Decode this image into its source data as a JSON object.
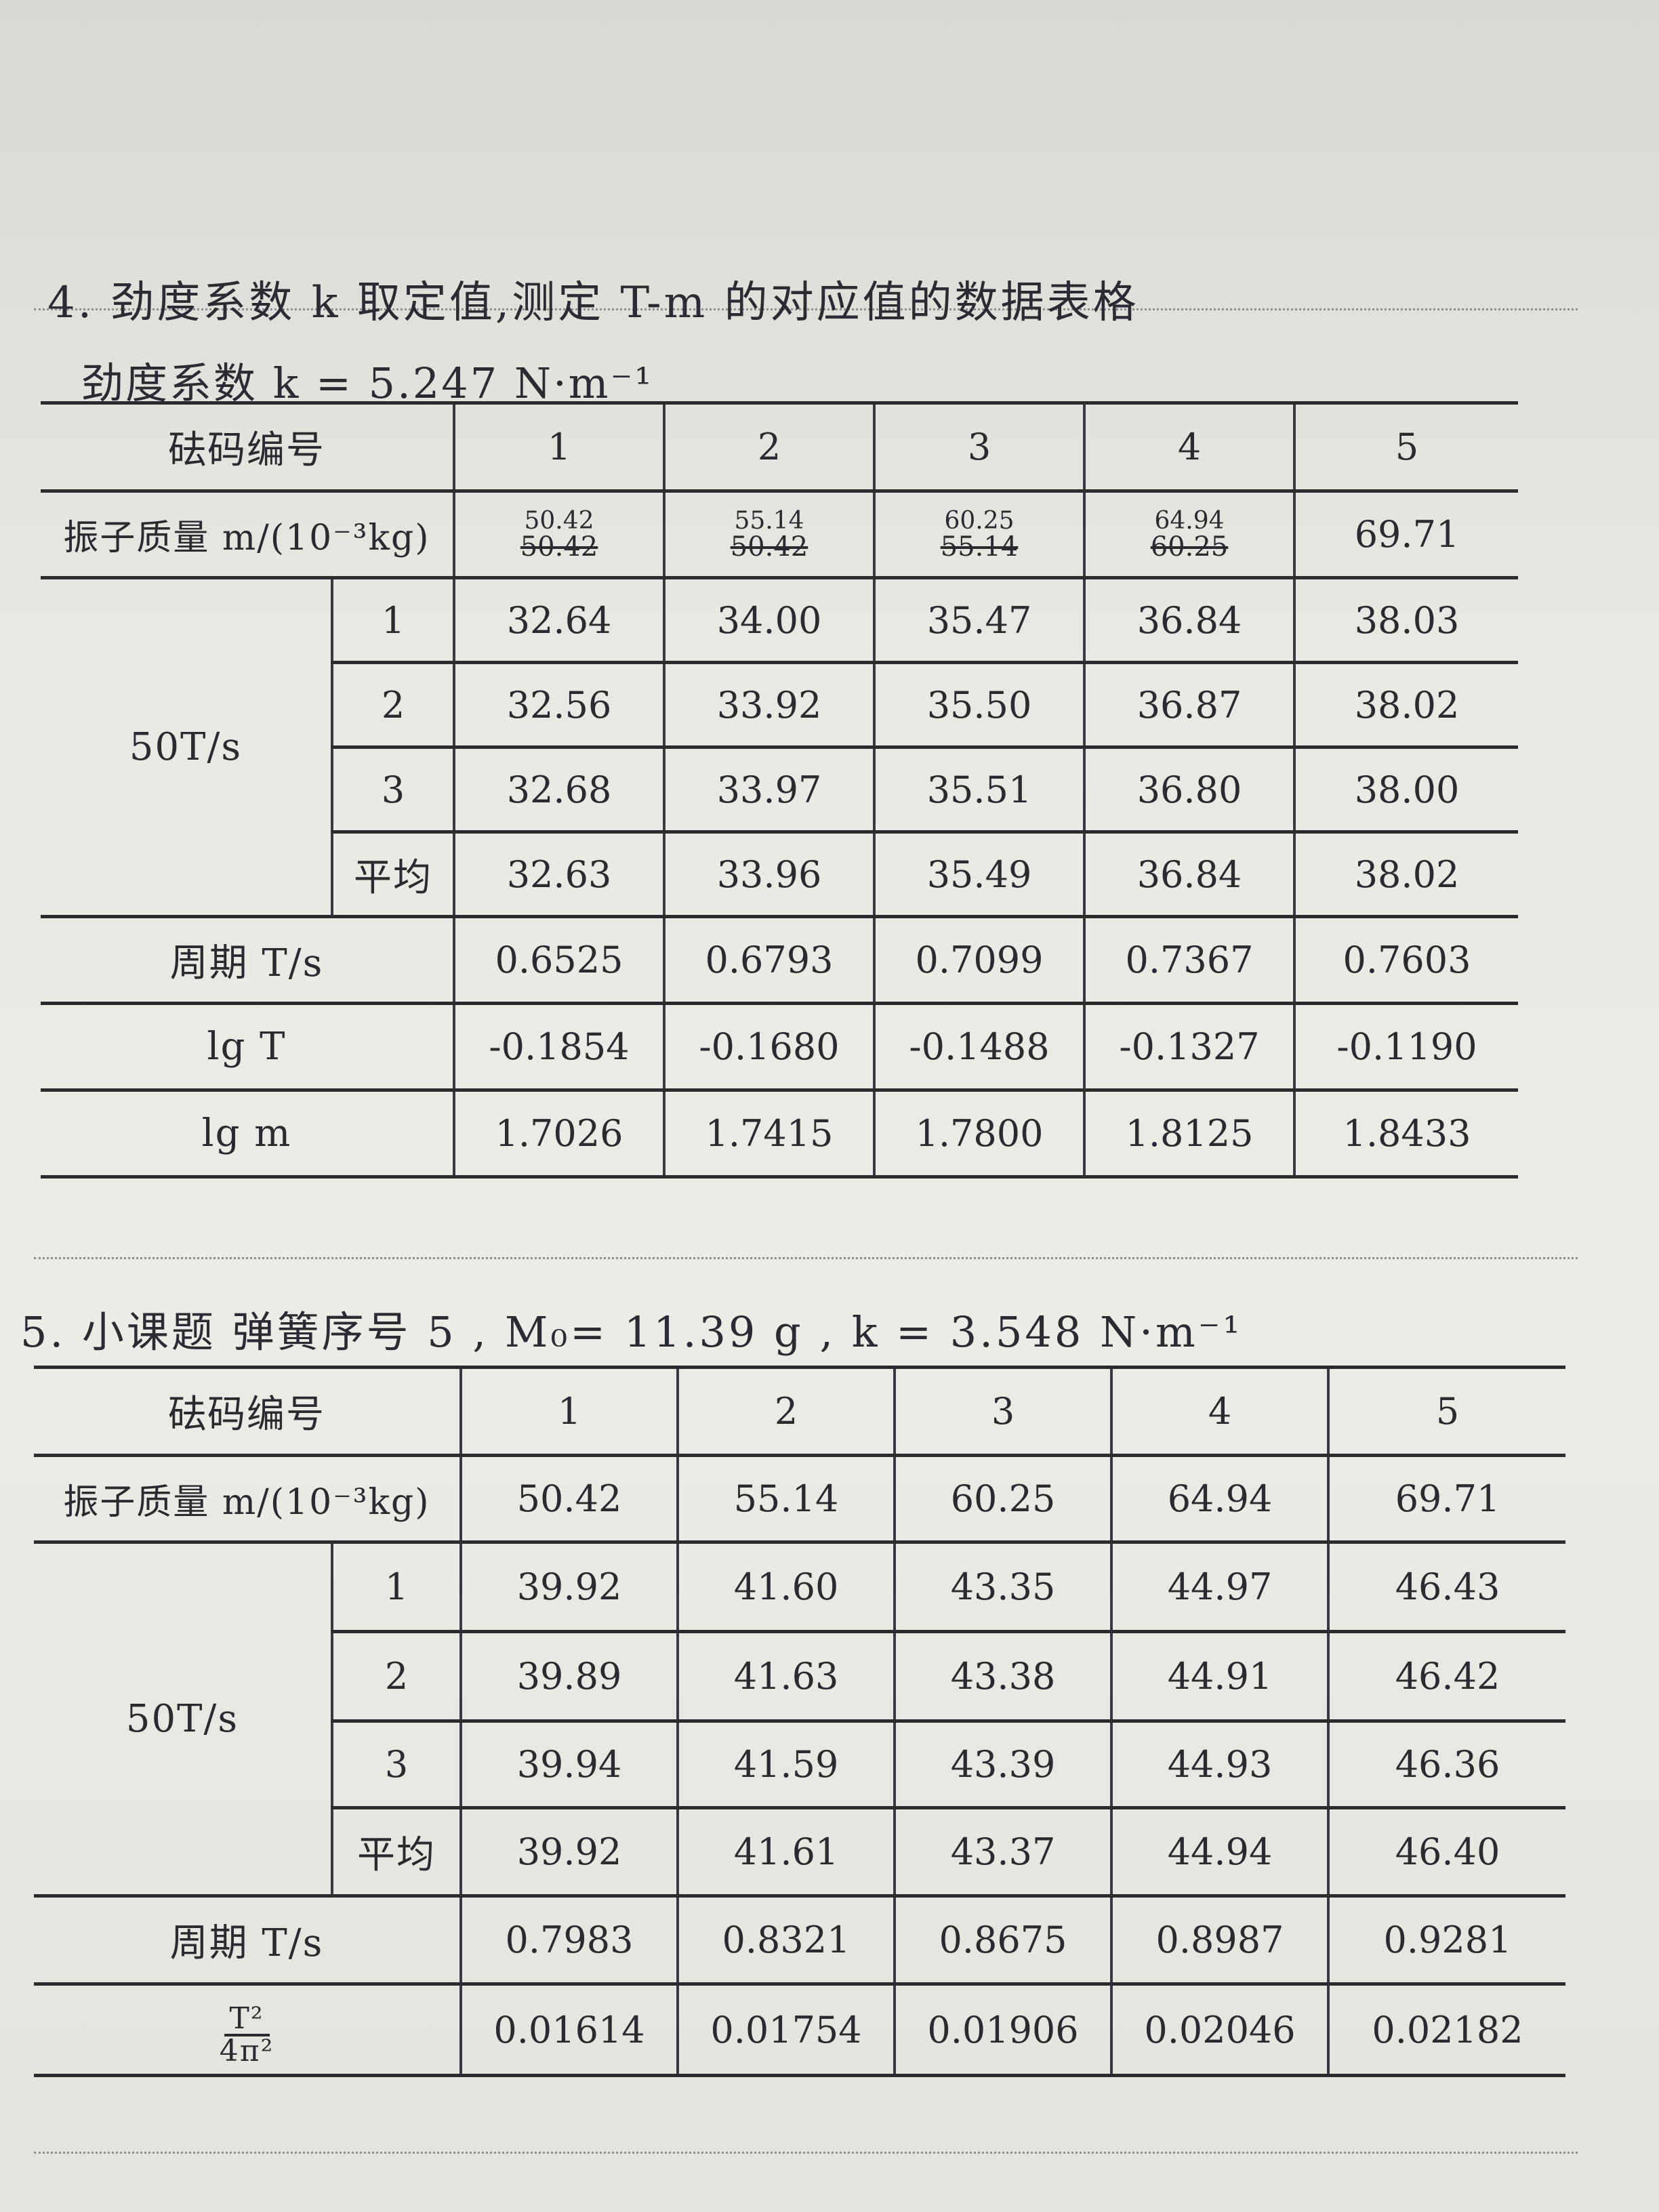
{
  "section4": {
    "heading": "4. 劲度系数 k 取定值,测定 T-m 的对应值的数据表格",
    "k_line": "劲度系数 k = 5.247 N·m⁻¹",
    "header_label": "砝码编号",
    "cols": [
      "1",
      "2",
      "3",
      "4",
      "5"
    ],
    "mass_label": "振子质量 m/(10⁻³kg)",
    "mass": [
      {
        "new": "50.42",
        "old": "50.42"
      },
      {
        "new": "55.14",
        "old": "50.42"
      },
      {
        "new": "60.25",
        "old": "55.14"
      },
      {
        "new": "64.94",
        "old": "60.25"
      },
      {
        "new": "69.71",
        "old": ""
      }
    ],
    "time_label": "50T/s",
    "trial_labels": [
      "1",
      "2",
      "3",
      "平均"
    ],
    "trials": [
      [
        "32.64",
        "34.00",
        "35.47",
        "36.84",
        "38.03"
      ],
      [
        "32.56",
        "33.92",
        "35.50",
        "36.87",
        "38.02"
      ],
      [
        "32.68",
        "33.97",
        "35.51",
        "36.80",
        "38.00"
      ],
      [
        "32.63",
        "33.96",
        "35.49",
        "36.84",
        "38.02"
      ]
    ],
    "period_label": "周期 T/s",
    "period": [
      "0.6525",
      "0.6793",
      "0.7099",
      "0.7367",
      "0.7603"
    ],
    "lgT_label": "lg T",
    "lgT": [
      "-0.1854",
      "-0.1680",
      "-0.1488",
      "-0.1327",
      "-0.1190"
    ],
    "lgm_label": "lg m",
    "lgm": [
      "1.7026",
      "1.7415",
      "1.7800",
      "1.8125",
      "1.8433"
    ]
  },
  "section5": {
    "heading": "5. 小课题  弹簧序号 5 , M₀= 11.39 g , k = 3.548  N·m⁻¹",
    "header_label": "砝码编号",
    "cols": [
      "1",
      "2",
      "3",
      "4",
      "5"
    ],
    "mass_label": "振子质量 m/(10⁻³kg)",
    "mass": [
      "50.42",
      "55.14",
      "60.25",
      "64.94",
      "69.71"
    ],
    "time_label": "50T/s",
    "trial_labels": [
      "1",
      "2",
      "3",
      "平均"
    ],
    "trials": [
      [
        "39.92",
        "41.60",
        "43.35",
        "44.97",
        "46.43"
      ],
      [
        "39.89",
        "41.63",
        "43.38",
        "44.91",
        "46.42"
      ],
      [
        "39.94",
        "41.59",
        "43.39",
        "44.93",
        "46.36"
      ],
      [
        "39.92",
        "41.61",
        "43.37",
        "44.94",
        "46.40"
      ]
    ],
    "period_label": "周期 T/s",
    "period": [
      "0.7983",
      "0.8321",
      "0.8675",
      "0.8987",
      "0.9281"
    ],
    "frac_label": {
      "num": "T²",
      "den": "4π²"
    },
    "frac_values": [
      "0.01614",
      "0.01754",
      "0.01906",
      "0.02046",
      "0.02182"
    ]
  }
}
